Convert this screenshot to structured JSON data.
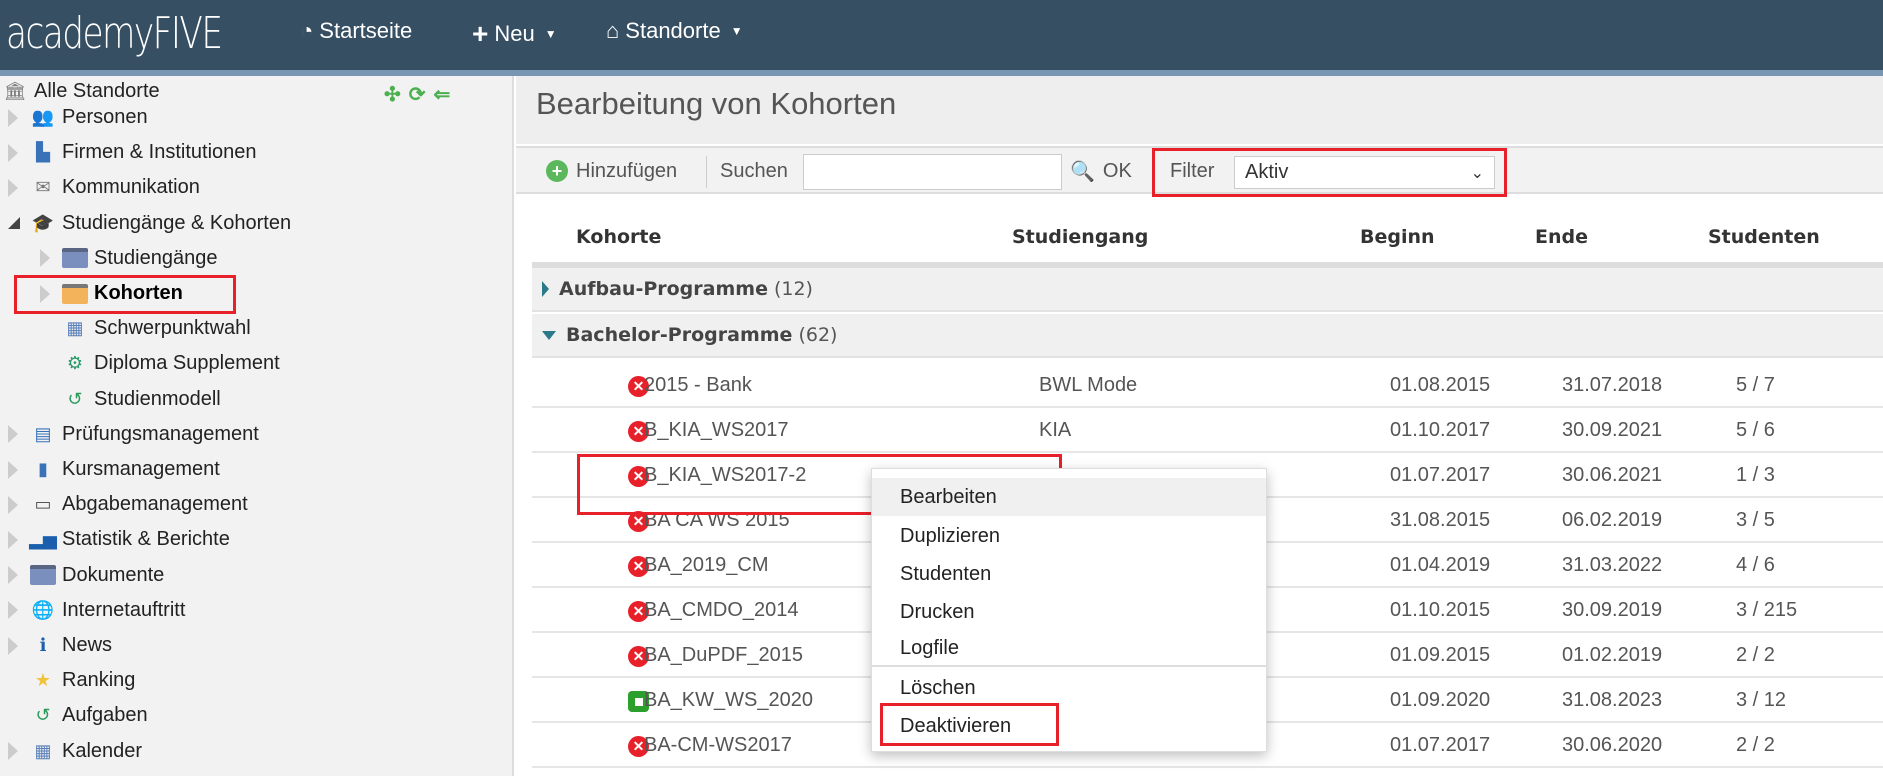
{
  "header": {
    "logo": "academyFIVE",
    "nav": [
      {
        "label": "Startseite",
        "icon": "dashboard-icon"
      },
      {
        "label": "Neu",
        "icon": "plus-icon"
      },
      {
        "label": "Standorte",
        "icon": "home-icon"
      }
    ]
  },
  "sidebar": {
    "root": "Alle Standorte",
    "items": [
      {
        "label": "Personen",
        "level": 0
      },
      {
        "label": "Firmen & Institutionen",
        "level": 0
      },
      {
        "label": "Kommunikation",
        "level": 0
      },
      {
        "label": "Studiengänge & Kohorten",
        "level": 0,
        "expanded": true
      },
      {
        "label": "Studiengänge",
        "level": 1
      },
      {
        "label": "Kohorten",
        "level": 1,
        "selected": true
      },
      {
        "label": "Schwerpunktwahl",
        "level": 1
      },
      {
        "label": "Diploma Supplement",
        "level": 1
      },
      {
        "label": "Studienmodell",
        "level": 1
      },
      {
        "label": "Prüfungsmanagement",
        "level": 0
      },
      {
        "label": "Kursmanagement",
        "level": 0
      },
      {
        "label": "Abgabemanagement",
        "level": 0
      },
      {
        "label": "Statistik & Berichte",
        "level": 0
      },
      {
        "label": "Dokumente",
        "level": 0
      },
      {
        "label": "Internetauftritt",
        "level": 0
      },
      {
        "label": "News",
        "level": 0
      },
      {
        "label": "Ranking",
        "level": 0
      },
      {
        "label": "Aufgaben",
        "level": 0
      },
      {
        "label": "Kalender",
        "level": 0
      }
    ]
  },
  "main": {
    "title": "Bearbeitung von Kohorten",
    "toolbar": {
      "add": "Hinzufügen",
      "search_label": "Suchen",
      "search_value": "",
      "ok": "OK",
      "filter_label": "Filter",
      "filter_value": "Aktiv"
    },
    "columns": [
      "Kohorte",
      "Studiengang",
      "Beginn",
      "Ende",
      "Studenten"
    ],
    "groups": [
      {
        "name": "Aufbau-Programme",
        "count": "(12)",
        "expanded": false
      },
      {
        "name": "Bachelor-Programme",
        "count": "(62)",
        "expanded": true
      }
    ],
    "rows": [
      {
        "name": "2015 - Bank",
        "program": "BWL Mode",
        "start": "01.08.2015",
        "end": "31.07.2018",
        "students": "5 / 7",
        "active": false
      },
      {
        "name": "B_KIA_WS2017",
        "program": "KIA",
        "start": "01.10.2017",
        "end": "30.09.2021",
        "students": "5 / 6",
        "active": false
      },
      {
        "name": "B_KIA_WS2017-2",
        "program": "",
        "start": "01.07.2017",
        "end": "30.06.2021",
        "students": "1 / 3",
        "active": false
      },
      {
        "name": "BA CA WS 2015",
        "program": "",
        "start": "31.08.2015",
        "end": "06.02.2019",
        "students": "3 / 5",
        "active": false
      },
      {
        "name": "BA_2019_CM",
        "program": "",
        "start": "01.04.2019",
        "end": "31.03.2022",
        "students": "4 / 6",
        "active": false
      },
      {
        "name": "BA_CMDO_2014",
        "program": "",
        "start": "01.10.2015",
        "end": "30.09.2019",
        "students": "3 / 215",
        "active": false
      },
      {
        "name": "BA_DuPDF_2015",
        "program": "",
        "start": "01.09.2015",
        "end": "01.02.2019",
        "students": "2 / 2",
        "active": false
      },
      {
        "name": "BA_KW_WS_2020",
        "program": "",
        "start": "01.09.2020",
        "end": "31.08.2023",
        "students": "3 / 12",
        "active": true
      },
      {
        "name": "BA-CM-WS2017",
        "program": "",
        "start": "01.07.2017",
        "end": "30.06.2020",
        "students": "2 / 2",
        "active": false
      }
    ]
  },
  "context_menu": {
    "items": [
      "Bearbeiten",
      "Duplizieren",
      "Studenten",
      "Drucken",
      "Logfile",
      "Löschen",
      "Deaktivieren"
    ],
    "highlighted": "Bearbeiten"
  },
  "colors": {
    "header": "#364f63",
    "highlight_box": "#e8202a",
    "inactive": "#e8202a",
    "active": "#2ca02c"
  }
}
